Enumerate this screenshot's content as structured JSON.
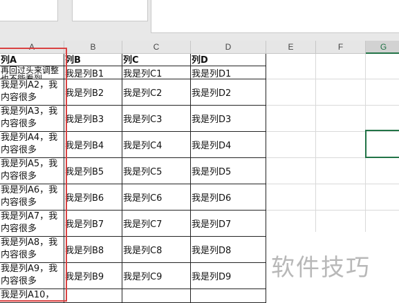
{
  "columns": [
    "A",
    "B",
    "C",
    "D",
    "E",
    "F",
    "G"
  ],
  "headers": [
    "列A",
    "列B",
    "列C",
    "列D"
  ],
  "first_row_a": "再回过头来调整也不能看到",
  "rows": [
    {
      "a": "我是列A2，我内容很多",
      "b": "我是列B2",
      "c": "我是列C2",
      "d": "我是列D2"
    },
    {
      "a": "我是列A3，我内容很多",
      "b": "我是列B3",
      "c": "我是列C3",
      "d": "我是列D3"
    },
    {
      "a": "我是列A4，我内容很多",
      "b": "我是列B4",
      "c": "我是列C4",
      "d": "我是列D4"
    },
    {
      "a": "我是列A5，我内容很多",
      "b": "我是列B5",
      "c": "我是列C5",
      "d": "我是列D5"
    },
    {
      "a": "我是列A6，我内容很多",
      "b": "我是列B6",
      "c": "我是列C6",
      "d": "我是列D6"
    },
    {
      "a": "我是列A7，我内容很多",
      "b": "我是列B7",
      "c": "我是列C7",
      "d": "我是列D7"
    },
    {
      "a": "我是列A8，我内容很多",
      "b": "我是列B8",
      "c": "我是列C8",
      "d": "我是列D8"
    },
    {
      "a": "我是列A9，我内容很多",
      "b": "我是列B9",
      "c": "我是列C9",
      "d": "我是列D9"
    },
    {
      "a": "我是列A10，",
      "b": "",
      "c": "",
      "d": ""
    }
  ],
  "row1": {
    "b": "我是列B1",
    "c": "我是列C1",
    "d": "我是列D1"
  },
  "watermark": "软件技巧",
  "colors": {
    "selection": "#217346",
    "highlight": "#d94040"
  }
}
